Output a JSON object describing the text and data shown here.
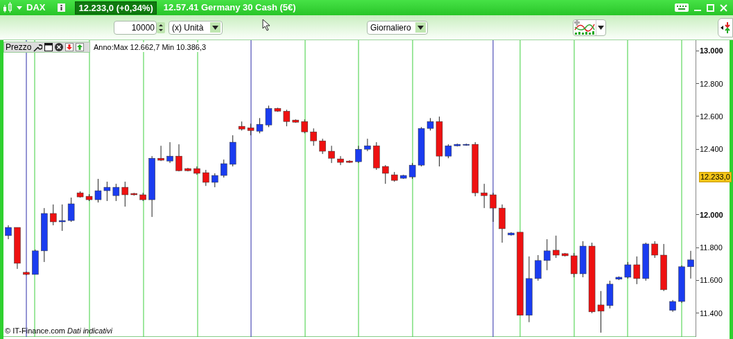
{
  "title_bar": {
    "symbol": "DAX",
    "price_badge": "12.233,0 (+0,34%)",
    "info": "12.57.41 Germany 30 Cash (5€)"
  },
  "toolbar": {
    "quantity": "10000",
    "unit": "(x) Unità",
    "period": "Giornaliero"
  },
  "chart": {
    "panel_label": "Prezzo",
    "stats": "Anno:Max 12.662,7 Min 10.386,3",
    "last_price": "12.233,0",
    "footer": "© IT-Finance.com *Dati indicativi*",
    "chart_data": {
      "type": "candlestick",
      "grid": true,
      "ylim": [
        11255,
        13065
      ],
      "yticks": [
        {
          "value": 13000,
          "label": "13.000"
        },
        {
          "value": 12800,
          "label": "12.800"
        },
        {
          "value": 12600,
          "label": "12.600"
        },
        {
          "value": 12400,
          "label": "12.400"
        },
        {
          "value": 12000,
          "label": "12.000"
        },
        {
          "value": 11800,
          "label": "11.800"
        },
        {
          "value": 11600,
          "label": "11.600"
        },
        {
          "value": 11400,
          "label": "11.400"
        }
      ],
      "ohlc": [
        [
          11873,
          11936,
          11851,
          11923
        ],
        [
          11923,
          11923,
          11670,
          11704
        ],
        [
          11649,
          11653,
          11632,
          11636
        ],
        [
          11636,
          11788,
          11636,
          11780
        ],
        [
          11780,
          12041,
          11712,
          12008
        ],
        [
          12008,
          12063,
          11936,
          11957
        ],
        [
          11957,
          12063,
          11902,
          11965
        ],
        [
          11965,
          12105,
          11957,
          12067
        ],
        [
          12134,
          12143,
          12105,
          12109
        ],
        [
          12113,
          12126,
          12084,
          12092
        ],
        [
          12092,
          12219,
          12075,
          12147
        ],
        [
          12147,
          12202,
          12084,
          12168
        ],
        [
          12117,
          12189,
          12084,
          12168
        ],
        [
          12168,
          12202,
          12050,
          12122
        ],
        [
          12130,
          12134,
          12117,
          12122
        ],
        [
          12122,
          12134,
          12084,
          12092
        ],
        [
          12092,
          12358,
          11987,
          12345
        ],
        [
          12345,
          12421,
          12328,
          12333
        ],
        [
          12328,
          12443,
          12316,
          12358
        ],
        [
          12358,
          12430,
          12265,
          12269
        ],
        [
          12282,
          12286,
          12265,
          12269
        ],
        [
          12282,
          12295,
          12244,
          12253
        ],
        [
          12257,
          12274,
          12176,
          12198
        ],
        [
          12198,
          12253,
          12168,
          12240
        ],
        [
          12240,
          12337,
          12227,
          12312
        ],
        [
          12308,
          12485,
          12295,
          12443
        ],
        [
          12540,
          12569,
          12514,
          12523
        ],
        [
          12531,
          12556,
          12485,
          12514
        ],
        [
          12510,
          12590,
          12497,
          12552
        ],
        [
          12548,
          12666,
          12535,
          12649
        ],
        [
          12649,
          12653,
          12628,
          12632
        ],
        [
          12632,
          12641,
          12540,
          12569
        ],
        [
          12578,
          12582,
          12561,
          12565
        ],
        [
          12569,
          12582,
          12497,
          12506
        ],
        [
          12506,
          12527,
          12421,
          12451
        ],
        [
          12451,
          12464,
          12371,
          12388
        ],
        [
          12388,
          12421,
          12316,
          12345
        ],
        [
          12341,
          12358,
          12303,
          12320
        ],
        [
          12328,
          12333,
          12316,
          12320
        ],
        [
          12324,
          12421,
          12316,
          12400
        ],
        [
          12400,
          12464,
          12388,
          12421
        ],
        [
          12421,
          12443,
          12274,
          12286
        ],
        [
          12295,
          12303,
          12189,
          12253
        ],
        [
          12244,
          12261,
          12202,
          12210
        ],
        [
          12223,
          12244,
          12219,
          12240
        ],
        [
          12231,
          12316,
          12219,
          12303
        ],
        [
          12303,
          12535,
          12295,
          12527
        ],
        [
          12527,
          12590,
          12514,
          12569
        ],
        [
          12569,
          12599,
          12295,
          12358
        ],
        [
          12358,
          12430,
          12345,
          12421
        ],
        [
          12421,
          12434,
          12417,
          12430
        ],
        [
          12426,
          12434,
          12421,
          12430
        ],
        [
          12430,
          12443,
          12113,
          12134
        ],
        [
          12134,
          12189,
          12041,
          12117
        ],
        [
          12122,
          12134,
          11957,
          12041
        ],
        [
          12041,
          12063,
          11830,
          11915
        ],
        [
          11877,
          11894,
          11873,
          11889
        ],
        [
          11894,
          11894,
          11387,
          11387
        ],
        [
          11387,
          11746,
          11345,
          11611
        ],
        [
          11611,
          11754,
          11598,
          11721
        ],
        [
          11721,
          11851,
          11662,
          11780
        ],
        [
          11784,
          11873,
          11737,
          11754
        ],
        [
          11763,
          11767,
          11746,
          11750
        ],
        [
          11750,
          11767,
          11619,
          11640
        ],
        [
          11640,
          11839,
          11619,
          11809
        ],
        [
          11809,
          11830,
          11400,
          11408
        ],
        [
          11450,
          11535,
          11281,
          11412
        ],
        [
          11446,
          11598,
          11429,
          11577
        ],
        [
          11607,
          11624,
          11602,
          11619
        ],
        [
          11619,
          11712,
          11611,
          11695
        ],
        [
          11695,
          11746,
          11577,
          11611
        ],
        [
          11611,
          11830,
          11598,
          11822
        ],
        [
          11822,
          11839,
          11737,
          11754
        ],
        [
          11754,
          11822,
          11535,
          11543
        ],
        [
          11417,
          11480,
          11408,
          11471
        ],
        [
          11471,
          11691,
          11463,
          11683
        ],
        [
          11683,
          11780,
          11611,
          11725
        ]
      ]
    }
  }
}
